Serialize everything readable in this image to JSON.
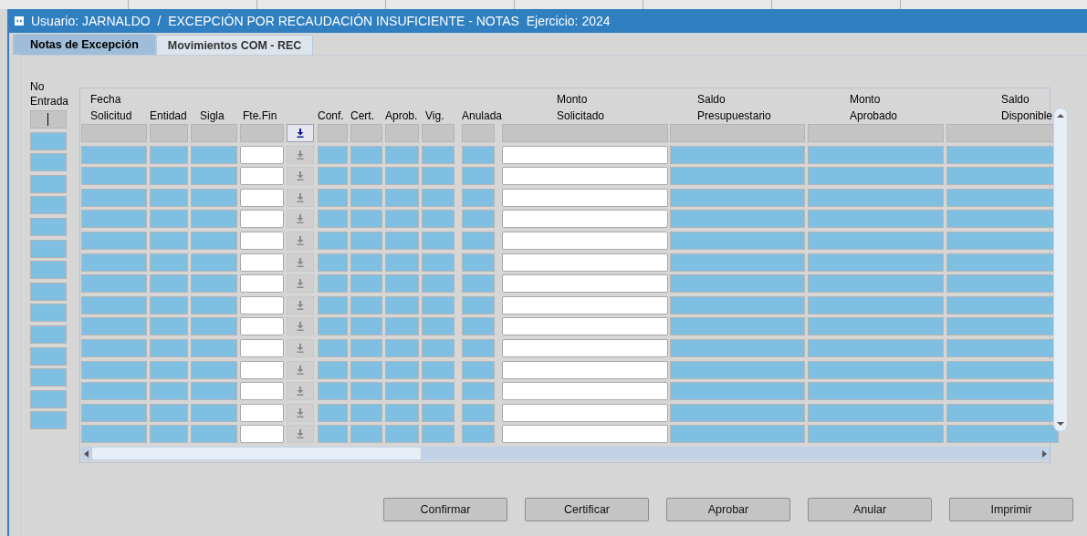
{
  "window": {
    "title": "Usuario: JARNALDO  /  EXCEPCIÓN POR RECAUDACIÓN INSUFICIENTE - NOTAS  Ejercicio: 2024"
  },
  "tabs": [
    {
      "label": "Notas de Excepción",
      "selected": true
    },
    {
      "label": "Movimientos COM - REC",
      "selected": false
    }
  ],
  "record_column": {
    "label": "No\nEntrada"
  },
  "table": {
    "columns": [
      {
        "label": "Fecha\nSolicitud",
        "kind": "display"
      },
      {
        "label": "Entidad",
        "kind": "display"
      },
      {
        "label": "Sigla",
        "kind": "display"
      },
      {
        "label": "Fte.Fin",
        "kind": "input"
      },
      {
        "kind": "button"
      },
      {
        "label": "Conf.",
        "kind": "display"
      },
      {
        "label": "Cert.",
        "kind": "display"
      },
      {
        "label": "Aprob.",
        "kind": "display"
      },
      {
        "label": "Vig.",
        "kind": "display"
      },
      {
        "label": "Anulada",
        "kind": "display"
      },
      {
        "label": "Monto\nSolicitado",
        "kind": "input"
      },
      {
        "label": "Saldo\nPresupuestario",
        "kind": "display"
      },
      {
        "label": "Monto\nAprobado",
        "kind": "display"
      },
      {
        "label": "Saldo\nDisponible",
        "kind": "display"
      }
    ],
    "rows": [
      {
        "current": true,
        "button_enabled": true
      },
      {
        "current": false,
        "button_enabled": false
      },
      {
        "current": false,
        "button_enabled": false
      },
      {
        "current": false,
        "button_enabled": false
      },
      {
        "current": false,
        "button_enabled": false
      },
      {
        "current": false,
        "button_enabled": false
      },
      {
        "current": false,
        "button_enabled": false
      },
      {
        "current": false,
        "button_enabled": false
      },
      {
        "current": false,
        "button_enabled": false
      },
      {
        "current": false,
        "button_enabled": false
      },
      {
        "current": false,
        "button_enabled": false
      },
      {
        "current": false,
        "button_enabled": false
      },
      {
        "current": false,
        "button_enabled": false
      },
      {
        "current": false,
        "button_enabled": false
      },
      {
        "current": false,
        "button_enabled": false
      }
    ]
  },
  "buttons": [
    "Confirmar",
    "Certificar",
    "Aprobar",
    "Anular",
    "Imprimir"
  ]
}
